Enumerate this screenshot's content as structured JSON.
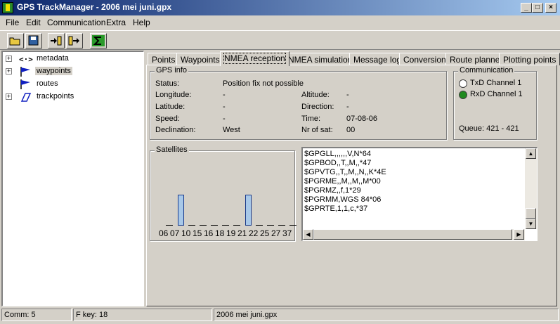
{
  "window": {
    "title": "GPS TrackManager - 2006 mei juni.gpx"
  },
  "menu": [
    "File",
    "Edit",
    "Communication",
    "Extra",
    "Help"
  ],
  "tree": [
    {
      "label": "metadata",
      "icon": "metadata-icon"
    },
    {
      "label": "waypoints",
      "icon": "flag-icon"
    },
    {
      "label": "routes",
      "icon": "flag-icon"
    },
    {
      "label": "trackpoints",
      "icon": "track-icon"
    }
  ],
  "tabs": [
    "Points",
    "Waypoints",
    "NMEA reception",
    "NMEA simulation",
    "Message log",
    "Conversion",
    "Route planner",
    "Plotting points"
  ],
  "active_tab": "NMEA reception",
  "gps_info": {
    "title": "GPS info",
    "status_label": "Status:",
    "status_value": "Position fix not possible",
    "longitude_label": "Longitude:",
    "longitude_value": "-",
    "latitude_label": "Latitude:",
    "latitude_value": "-",
    "speed_label": "Speed:",
    "speed_value": "-",
    "declination_label": "Declination:",
    "declination_value": "West",
    "altitude_label": "Altitude:",
    "altitude_value": "-",
    "direction_label": "Direction:",
    "direction_value": "-",
    "time_label": "Time:",
    "time_value": "07-08-06",
    "nrsat_label": "Nr of sat:",
    "nrsat_value": "00"
  },
  "communication": {
    "title": "Communication",
    "txd": "TxD Channel 1",
    "rxd": "RxD Channel 1",
    "queue": "Queue: 421 - 421"
  },
  "satellites": {
    "title": "Satellites",
    "ids": [
      "06",
      "07",
      "10",
      "15",
      "16",
      "18",
      "19",
      "21",
      "22",
      "25",
      "27",
      "37"
    ],
    "signal": [
      0,
      1,
      0,
      0,
      0,
      0,
      0,
      1,
      0,
      0,
      0,
      0
    ]
  },
  "nmea_lines": [
    "$GPGLL,,,,,,V,N*64",
    "$GPBOD,,T,,M,,*47",
    "$GPVTG,,T,,M,,N,,K*4E",
    "$PGRME,,M,,M,,M*00",
    "$PGRMZ,,f,1*29",
    "$PGRMM,WGS 84*06",
    "$GPRTE,1,1,c,*37"
  ],
  "status": {
    "comm": "Comm: 5",
    "fkey": "F key: 18",
    "file": "2006 mei juni.gpx"
  },
  "colors": {
    "titlebar_start": "#0a246a",
    "titlebar_end": "#a6caf0",
    "rxd_led": "#1f8a1f"
  }
}
